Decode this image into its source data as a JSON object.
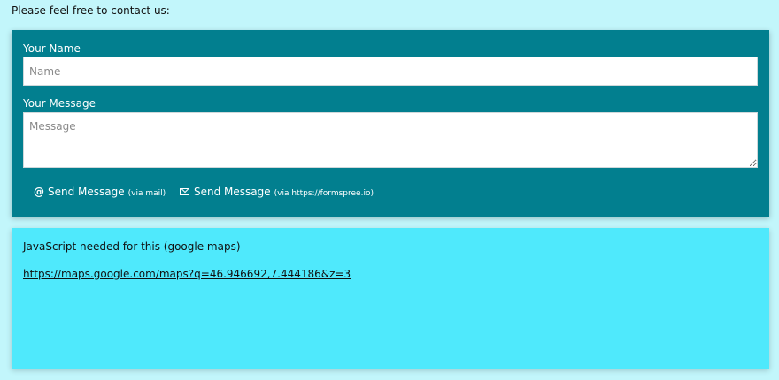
{
  "intro_text": "Please feel free to contact us:",
  "form": {
    "name_label": "Your Name",
    "name_placeholder": "Name",
    "name_value": "",
    "message_label": "Your Message",
    "message_placeholder": "Message",
    "message_value": "",
    "send_mail": {
      "icon": "at-icon",
      "icon_glyph": "@",
      "label": "Send Message",
      "via": "(via mail)"
    },
    "send_formspree": {
      "icon": "envelope-icon",
      "label": "Send Message",
      "via": "(via https://formspree.io)"
    }
  },
  "map": {
    "note": "JavaScript needed for this (google maps)",
    "link_text": "https://maps.google.com/maps?q=46.946692,7.444186&z=3"
  },
  "colors": {
    "page_background": "#c2f6fb",
    "form_background": "#027f8f",
    "map_background": "#4fe9fc"
  }
}
